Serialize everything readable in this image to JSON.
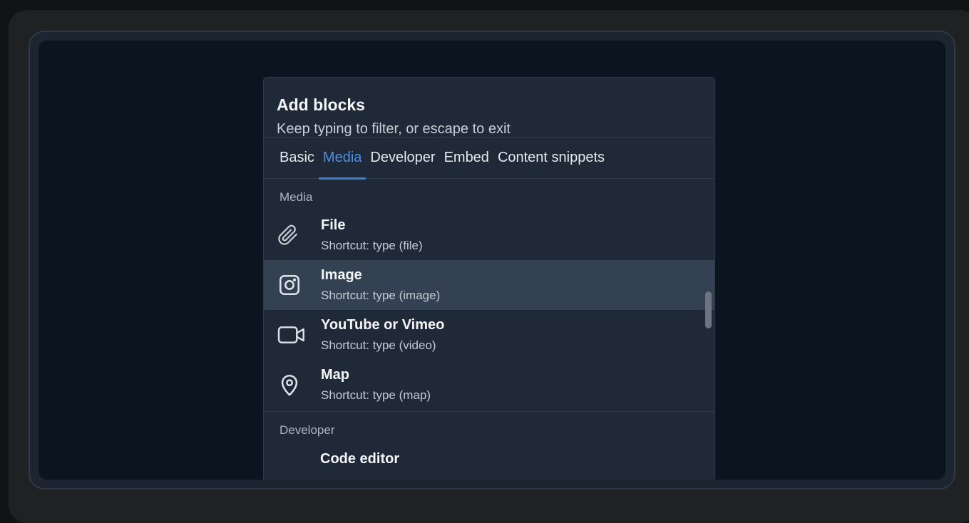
{
  "popover": {
    "title": "Add blocks",
    "subtitle": "Keep typing to filter, or escape to exit"
  },
  "tabs": [
    {
      "label": "Basic",
      "active": false
    },
    {
      "label": "Media",
      "active": true
    },
    {
      "label": "Developer",
      "active": false
    },
    {
      "label": "Embed",
      "active": false
    },
    {
      "label": "Content snippets",
      "active": false
    }
  ],
  "sections": {
    "media": {
      "label": "Media",
      "items": [
        {
          "title": "File",
          "shortcut": "Shortcut: type (file)",
          "icon": "paperclip-icon"
        },
        {
          "title": "Image",
          "shortcut": "Shortcut: type (image)",
          "icon": "image-icon",
          "selected": true
        },
        {
          "title": "YouTube or Vimeo",
          "shortcut": "Shortcut: type (video)",
          "icon": "video-camera-icon"
        },
        {
          "title": "Map",
          "shortcut": "Shortcut: type (map)",
          "icon": "map-pin-icon"
        }
      ]
    },
    "developer": {
      "label": "Developer",
      "items": [
        {
          "title": "Code editor"
        }
      ]
    }
  },
  "colors": {
    "accent": "#4d8fe0",
    "popover_bg": "#1f2937",
    "selected_bg": "#344152",
    "screen_bg": "#0c1420"
  }
}
